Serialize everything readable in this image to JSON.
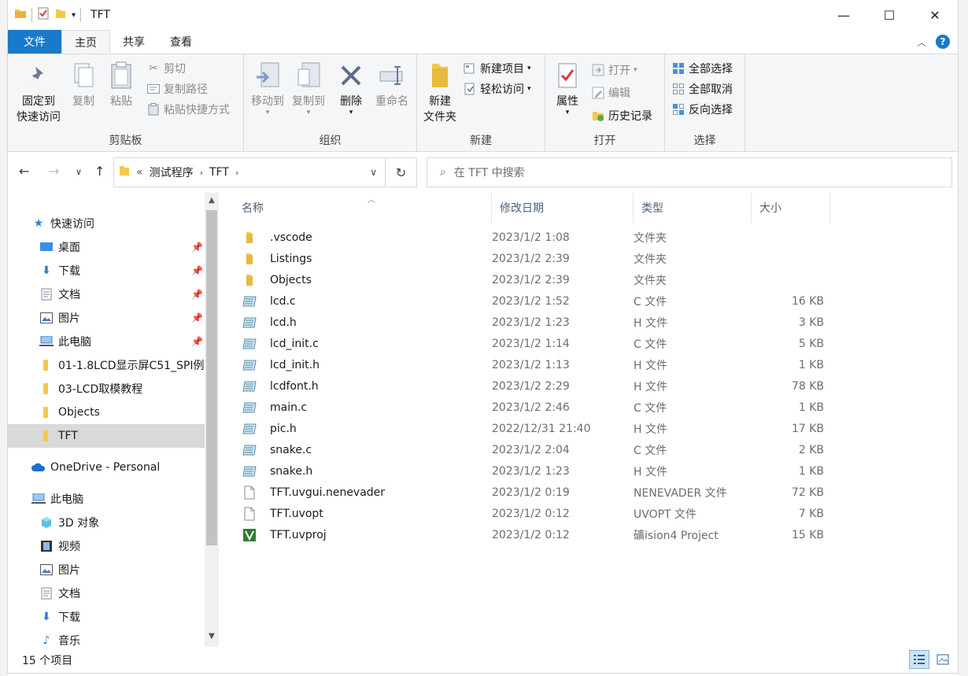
{
  "window": {
    "title": "TFT",
    "caption": {
      "minimize": "—",
      "maximize": "☐",
      "close": "✕"
    }
  },
  "tabs": {
    "file": "文件",
    "home": "主页",
    "share": "共享",
    "view": "查看"
  },
  "ribbon": {
    "clipboard": {
      "label": "剪贴板",
      "pin": "固定到\n快速访问",
      "pin_l1": "固定到",
      "pin_l2": "快速访问",
      "copy": "复制",
      "paste": "粘贴",
      "cut": "剪切",
      "copy_path": "复制路径",
      "paste_shortcut": "粘贴快捷方式"
    },
    "organize": {
      "label": "组织",
      "move_to": "移动到",
      "copy_to": "复制到",
      "delete": "删除",
      "rename": "重命名"
    },
    "new": {
      "label": "新建",
      "new_folder_l1": "新建",
      "new_folder_l2": "文件夹",
      "new_item": "新建项目",
      "easy_access": "轻松访问"
    },
    "open": {
      "label": "打开",
      "properties": "属性",
      "open": "打开",
      "edit": "编辑",
      "history": "历史记录"
    },
    "select": {
      "label": "选择",
      "select_all": "全部选择",
      "select_none": "全部取消",
      "invert": "反向选择"
    }
  },
  "address": {
    "prefix": "«",
    "crumb1": "测试程序",
    "crumb2": "TFT",
    "search_placeholder": "在 TFT 中搜索"
  },
  "nav": {
    "quick_access": "快速访问",
    "items": [
      {
        "label": "桌面"
      },
      {
        "label": "下载"
      },
      {
        "label": "文档"
      },
      {
        "label": "图片"
      },
      {
        "label": "此电脑"
      },
      {
        "label": "01-1.8LCD显示屏C51_SPI例"
      },
      {
        "label": "03-LCD取模教程"
      },
      {
        "label": "Objects"
      },
      {
        "label": "TFT"
      }
    ],
    "onedrive": "OneDrive - Personal",
    "this_pc": "此电脑",
    "pc_items": [
      {
        "label": "3D 对象"
      },
      {
        "label": "视频"
      },
      {
        "label": "图片"
      },
      {
        "label": "文档"
      },
      {
        "label": "下载"
      },
      {
        "label": "音乐"
      }
    ]
  },
  "columns": {
    "name": "名称",
    "date": "修改日期",
    "type": "类型",
    "size": "大小"
  },
  "files": [
    {
      "name": ".vscode",
      "date": "2023/1/2 1:08",
      "type": "文件夹",
      "size": "",
      "kind": "folder"
    },
    {
      "name": "Listings",
      "date": "2023/1/2 2:39",
      "type": "文件夹",
      "size": "",
      "kind": "folder"
    },
    {
      "name": "Objects",
      "date": "2023/1/2 2:39",
      "type": "文件夹",
      "size": "",
      "kind": "folder"
    },
    {
      "name": "lcd.c",
      "date": "2023/1/2 1:52",
      "type": "C 文件",
      "size": "16 KB",
      "kind": "code"
    },
    {
      "name": "lcd.h",
      "date": "2023/1/2 1:23",
      "type": "H 文件",
      "size": "3 KB",
      "kind": "code"
    },
    {
      "name": "lcd_init.c",
      "date": "2023/1/2 1:14",
      "type": "C 文件",
      "size": "5 KB",
      "kind": "code"
    },
    {
      "name": "lcd_init.h",
      "date": "2023/1/2 1:13",
      "type": "H 文件",
      "size": "1 KB",
      "kind": "code"
    },
    {
      "name": "lcdfont.h",
      "date": "2023/1/2 2:29",
      "type": "H 文件",
      "size": "78 KB",
      "kind": "code"
    },
    {
      "name": "main.c",
      "date": "2023/1/2 2:46",
      "type": "C 文件",
      "size": "1 KB",
      "kind": "code"
    },
    {
      "name": "pic.h",
      "date": "2022/12/31 21:40",
      "type": "H 文件",
      "size": "17 KB",
      "kind": "code"
    },
    {
      "name": "snake.c",
      "date": "2023/1/2 2:04",
      "type": "C 文件",
      "size": "2 KB",
      "kind": "code"
    },
    {
      "name": "snake.h",
      "date": "2023/1/2 1:23",
      "type": "H 文件",
      "size": "1 KB",
      "kind": "code"
    },
    {
      "name": "TFT.uvgui.nenevader",
      "date": "2023/1/2 0:19",
      "type": "NENEVADER 文件",
      "size": "72 KB",
      "kind": "blank"
    },
    {
      "name": "TFT.uvopt",
      "date": "2023/1/2 0:12",
      "type": "UVOPT 文件",
      "size": "7 KB",
      "kind": "blank"
    },
    {
      "name": "TFT.uvproj",
      "date": "2023/1/2 0:12",
      "type": "礦ision4 Project",
      "size": "15 KB",
      "kind": "uv"
    }
  ],
  "status": {
    "count": "15 个项目"
  },
  "colors": {
    "accent": "#1979ca",
    "folder": "#f2c94c",
    "selected": "#d9d9d9"
  }
}
